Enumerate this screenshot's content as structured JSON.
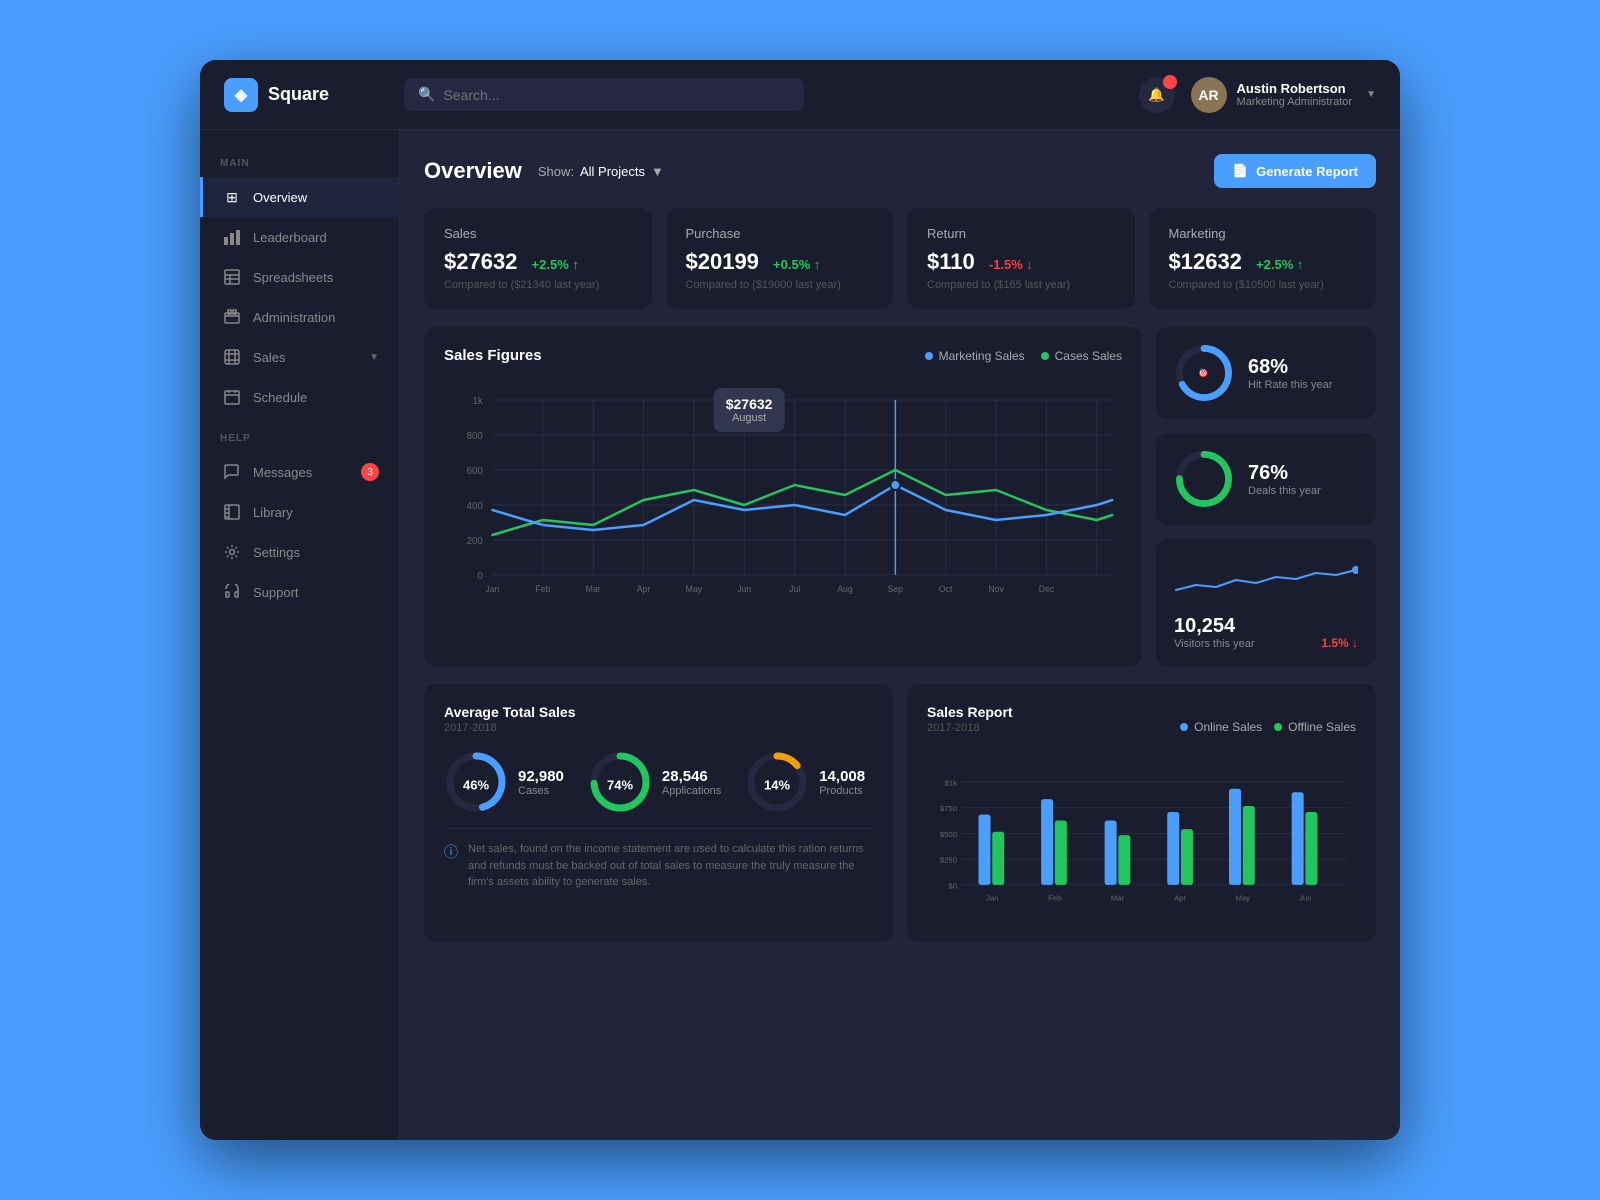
{
  "app": {
    "name": "Square",
    "logo_char": "◈"
  },
  "header": {
    "search_placeholder": "Search...",
    "notification_count": "",
    "user": {
      "name": "Austin Robertson",
      "role": "Marketing Administrator",
      "avatar_initials": "AR"
    }
  },
  "sidebar": {
    "sections": [
      {
        "label": "MAIN",
        "items": [
          {
            "id": "overview",
            "label": "Overview",
            "icon": "⊞",
            "active": true
          },
          {
            "id": "leaderboard",
            "label": "Leaderboard",
            "icon": "📊",
            "active": false
          },
          {
            "id": "spreadsheets",
            "label": "Spreadsheets",
            "icon": "⊟",
            "active": false
          },
          {
            "id": "administration",
            "label": "Administration",
            "icon": "💳",
            "active": false
          },
          {
            "id": "sales",
            "label": "Sales",
            "icon": "🏷",
            "active": false,
            "has_chevron": true
          },
          {
            "id": "schedule",
            "label": "Schedule",
            "icon": "📅",
            "active": false
          }
        ]
      },
      {
        "label": "HELP",
        "items": [
          {
            "id": "messages",
            "label": "Messages",
            "icon": "💬",
            "active": false,
            "badge": "3"
          },
          {
            "id": "library",
            "label": "Library",
            "icon": "📖",
            "active": false
          },
          {
            "id": "settings",
            "label": "Settings",
            "icon": "⚙",
            "active": false
          },
          {
            "id": "support",
            "label": "Support",
            "icon": "📞",
            "active": false
          }
        ]
      }
    ]
  },
  "page": {
    "title": "Overview",
    "filter": {
      "label": "Show:",
      "value": "All Projects"
    },
    "generate_btn": "Generate Report"
  },
  "stats": [
    {
      "label": "Sales",
      "value": "$27632",
      "change": "+2.5% ↑",
      "change_type": "positive",
      "compare": "Compared to ($21340 last year)"
    },
    {
      "label": "Purchase",
      "value": "$20199",
      "change": "+0.5% ↑",
      "change_type": "positive",
      "compare": "Compared to ($19000 last year)"
    },
    {
      "label": "Return",
      "value": "$110",
      "change": "-1.5% ↓",
      "change_type": "negative",
      "compare": "Compared to ($165 last year)"
    },
    {
      "label": "Marketing",
      "value": "$12632",
      "change": "+2.5% ↑",
      "change_type": "positive",
      "compare": "Compared to ($10500 last year)"
    }
  ],
  "sales_chart": {
    "title": "Sales Figures",
    "legend": [
      {
        "label": "Marketing Sales",
        "color": "#4a9eff"
      },
      {
        "label": "Cases Sales",
        "color": "#22c55e"
      }
    ],
    "months": [
      "Jan",
      "Feb",
      "Mar",
      "Apr",
      "May",
      "Jun",
      "Jul",
      "Aug",
      "Sep",
      "Oct",
      "Nov",
      "Dec"
    ],
    "y_labels": [
      "1k",
      "800",
      "600",
      "400",
      "200",
      "0"
    ],
    "tooltip": {
      "value": "$27632",
      "month": "August"
    }
  },
  "metrics": [
    {
      "id": "hit-rate",
      "pct": "68%",
      "label": "Hit Rate this year",
      "color": "#4a9eff",
      "icon": "🎯",
      "donut_pct": 68
    },
    {
      "id": "deals",
      "pct": "76%",
      "label": "Deals this year",
      "color": "#22c55e",
      "icon": "💼",
      "donut_pct": 76
    }
  ],
  "visitors": {
    "count": "10,254",
    "label": "Visitors this year",
    "change": "1.5% ↓",
    "change_type": "negative"
  },
  "avg_sales": {
    "title": "Average Total Sales",
    "subtitle": "2017-2018",
    "items": [
      {
        "pct": 46,
        "pct_label": "46%",
        "value": "92,980",
        "label": "Cases",
        "color": "#4a9eff"
      },
      {
        "pct": 74,
        "pct_label": "74%",
        "value": "28,546",
        "label": "Applications",
        "color": "#22c55e"
      },
      {
        "pct": 14,
        "pct_label": "14%",
        "value": "14,008",
        "label": "Products",
        "color": "#f59e0b"
      }
    ],
    "info_text": "Net sales, found on the income statement are used to calculate this ration returns and refunds must be backed out of total sales to measure the truly measure the firm's assets ability to generate sales."
  },
  "sales_report": {
    "title": "Sales Report",
    "subtitle": "2017-2018",
    "legend": [
      {
        "label": "Online Sales",
        "color": "#4a9eff"
      },
      {
        "label": "Offline Sales",
        "color": "#22c55e"
      }
    ],
    "months": [
      "Jan",
      "Feb",
      "Mar",
      "Apr",
      "May",
      "Jun"
    ],
    "y_labels": [
      "$1k",
      "$750",
      "$500",
      "$250",
      "$0"
    ]
  }
}
